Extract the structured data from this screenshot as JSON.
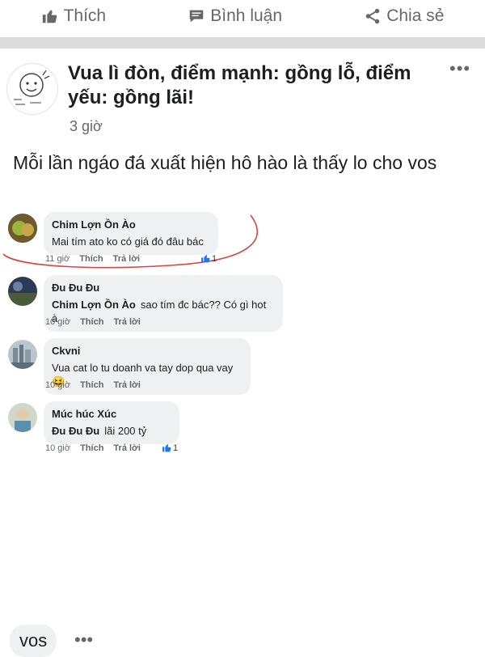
{
  "actions": {
    "like": "Thích",
    "comment": "Bình luận",
    "share": "Chia sẻ"
  },
  "post": {
    "group_title": "Vua lì đòn, điểm mạnh: gồng lỗ, điểm yếu: gồng lãi!",
    "time": "3 giờ",
    "more": "•••",
    "text": "Mỗi lần ngáo đá xuất hiện hô hào là thấy lo cho vos"
  },
  "comments": [
    {
      "name": "Chim Lợn Ồn Ào",
      "mention": "",
      "text": "Mai tím ato ko có giá đó đâu bác",
      "time": "11 giờ",
      "like": "Thích",
      "reply": "Trả lời",
      "likes": "1"
    },
    {
      "name": "Đu Đu Đu",
      "mention": "Chim Lợn Ồn Ào",
      "text": "sao tím đc bác?? Có gì hot à",
      "time": "10 giờ",
      "like": "Thích",
      "reply": "Trả lời",
      "likes": ""
    },
    {
      "name": "Ckvni",
      "mention": "",
      "text": "Vua cat lo tu doanh va tay dop qua vay😆",
      "time": "10 giờ",
      "like": "Thích",
      "reply": "Trả lời",
      "likes": ""
    },
    {
      "name": "Múc húc Xúc",
      "mention": "Đu Đu Đu",
      "text": "lãi 200 tỷ",
      "time": "10 giờ",
      "like": "Thích",
      "reply": "Trả lời",
      "likes": "1"
    }
  ],
  "composer": {
    "text": "vos",
    "more": "•••"
  },
  "colors": {
    "highlight_oval": "#d7463f",
    "reaction": "#1877f2",
    "muted": "#65676b"
  }
}
